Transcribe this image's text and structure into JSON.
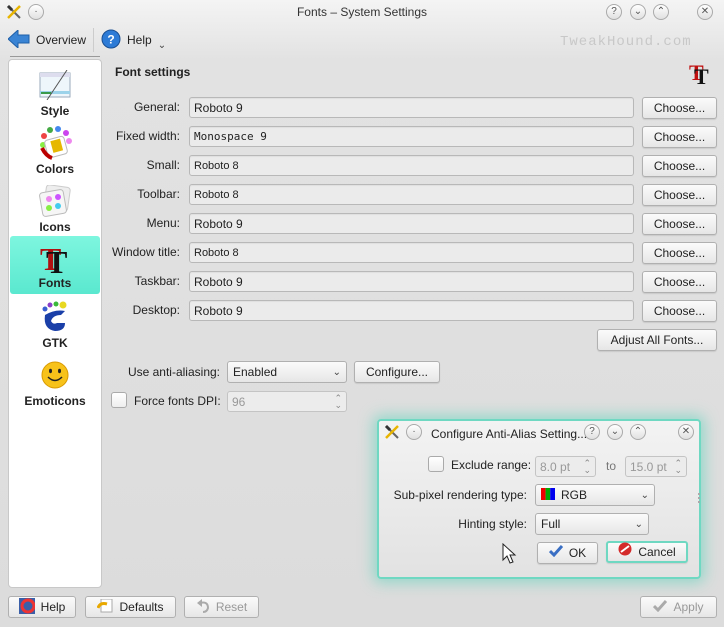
{
  "window": {
    "title": "Fonts – System Settings",
    "watermark": "TweakHound.com"
  },
  "toolbar": {
    "overview_label": "Overview",
    "help_label": "Help"
  },
  "sidebar": {
    "items": [
      {
        "label": "Style",
        "icon": "style-icon"
      },
      {
        "label": "Colors",
        "icon": "colors-icon"
      },
      {
        "label": "Icons",
        "icon": "icons-icon"
      },
      {
        "label": "Fonts",
        "icon": "fonts-icon",
        "active": true
      },
      {
        "label": "GTK",
        "icon": "gtk-icon"
      },
      {
        "label": "Emoticons",
        "icon": "emoticons-icon"
      }
    ]
  },
  "main": {
    "section_title": "Font settings",
    "choose_label": "Choose...",
    "fonts": [
      {
        "label": "General:",
        "value": "Roboto 9"
      },
      {
        "label": "Fixed width:",
        "value": "Monospace 9"
      },
      {
        "label": "Small:",
        "value": "Roboto 8"
      },
      {
        "label": "Toolbar:",
        "value": "Roboto 8"
      },
      {
        "label": "Menu:",
        "value": "Roboto 9"
      },
      {
        "label": "Window title:",
        "value": "Roboto 8"
      },
      {
        "label": "Taskbar:",
        "value": "Roboto 9"
      },
      {
        "label": "Desktop:",
        "value": "Roboto 9"
      }
    ],
    "adjust_all_label": "Adjust All Fonts...",
    "antialias_label": "Use anti-aliasing:",
    "antialias_value": "Enabled",
    "configure_label": "Configure...",
    "force_dpi_label": "Force fonts DPI:",
    "force_dpi_value": "96",
    "force_dpi_checked": false
  },
  "dialog": {
    "title": "Configure Anti-Alias Setting...",
    "exclude_label": "Exclude range:",
    "exclude_checked": false,
    "range_from": "8.0 pt",
    "range_to_label": "to",
    "range_to": "15.0 pt",
    "subpixel_label": "Sub-pixel rendering type:",
    "subpixel_value": "RGB",
    "hinting_label": "Hinting style:",
    "hinting_value": "Full",
    "ok_label": "OK",
    "cancel_label": "Cancel"
  },
  "footer": {
    "help_label": "Help",
    "defaults_label": "Defaults",
    "reset_label": "Reset",
    "apply_label": "Apply"
  },
  "colors": {
    "accent": "#5ae8cf",
    "dialog_glow": "#6fd8c2"
  }
}
